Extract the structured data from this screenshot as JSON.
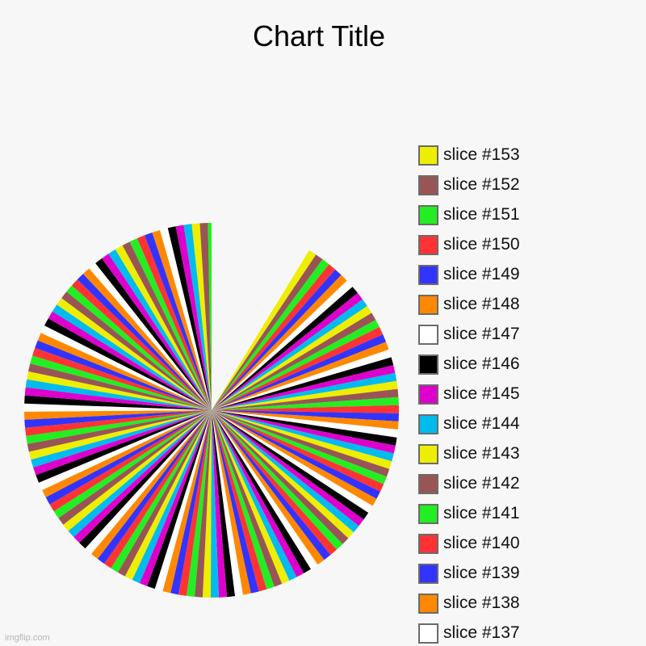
{
  "watermark": "imgflip.com",
  "chart_data": {
    "type": "pie",
    "title": "Chart Title",
    "legend_position": "right",
    "color_cycle_by_slice_mod10": {
      "0": "#ff3333",
      "1": "#22ee22",
      "2": "#995555",
      "3": "#eeee00",
      "4": "#00bbee",
      "5": "#dd00cc",
      "6": "#000000",
      "7": "#ffffff",
      "8": "#ff8800",
      "9": "#3333ff"
    },
    "slice_count": 153,
    "slice_label_prefix": "slice #",
    "slice_value_each": 1,
    "visible_slices": {
      "from": 153,
      "to": 21,
      "direction": "clockwise"
    },
    "legend_entries": [
      {
        "label": "slice #153",
        "color": "#eeee00"
      },
      {
        "label": "slice #152",
        "color": "#995555"
      },
      {
        "label": "slice #151",
        "color": "#22ee22"
      },
      {
        "label": "slice #150",
        "color": "#ff3333"
      },
      {
        "label": "slice #149",
        "color": "#3333ff"
      },
      {
        "label": "slice #148",
        "color": "#ff8800"
      },
      {
        "label": "slice #147",
        "color": "#ffffff"
      },
      {
        "label": "slice #146",
        "color": "#000000"
      },
      {
        "label": "slice #145",
        "color": "#dd00cc"
      },
      {
        "label": "slice #144",
        "color": "#00bbee"
      },
      {
        "label": "slice #143",
        "color": "#eeee00"
      },
      {
        "label": "slice #142",
        "color": "#995555"
      },
      {
        "label": "slice #141",
        "color": "#22ee22"
      },
      {
        "label": "slice #140",
        "color": "#ff3333"
      },
      {
        "label": "slice #139",
        "color": "#3333ff"
      },
      {
        "label": "slice #138",
        "color": "#ff8800"
      },
      {
        "label": "slice #137",
        "color": "#ffffff"
      }
    ]
  }
}
